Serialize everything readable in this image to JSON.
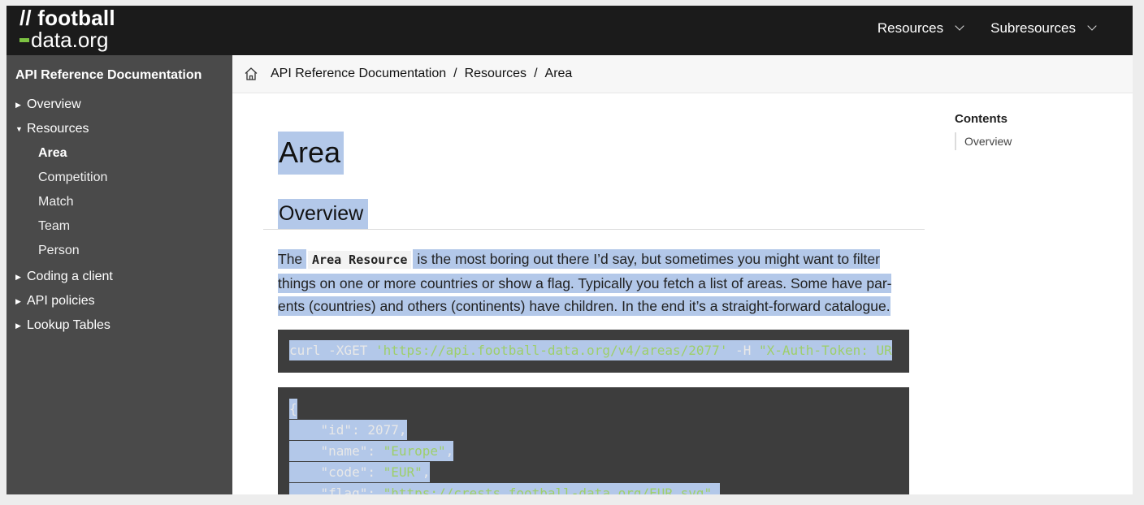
{
  "header": {
    "logo_line1": "// football",
    "logo_line2": "data.org",
    "nav": [
      {
        "label": "Resources"
      },
      {
        "label": "Subresources"
      }
    ]
  },
  "sidebar": {
    "title": "API Reference Documentation",
    "items": [
      {
        "label": "Overview",
        "expanded": false
      },
      {
        "label": "Resources",
        "expanded": true,
        "children": [
          "Area",
          "Competition",
          "Match",
          "Team",
          "Person"
        ],
        "active_child": "Area"
      },
      {
        "label": "Coding a client",
        "expanded": false
      },
      {
        "label": "API policies",
        "expanded": false
      },
      {
        "label": "Lookup Tables",
        "expanded": false
      }
    ]
  },
  "breadcrumb": [
    "API Reference Documentation",
    "Resources",
    "Area"
  ],
  "breadcrumb_sep": "/",
  "content": {
    "title": "Area",
    "section_heading": "Overview",
    "paragraph": {
      "before": "The",
      "code": "Area Resource",
      "after_line1": "is the most boring out there I’d say, but sometimes you might want to filter",
      "line2": "things on one or more countries or show a flag. Typically you fetch a list of areas. Some have par-",
      "line3": "ents (countries) and others (continents) have children. In the end it’s a straight-forward catalogue."
    },
    "curl": {
      "cmd": "curl -XGET",
      "url": "'https://api.football-data.org/v4/areas/2077'",
      "flag": "-H",
      "header": "\"X-Auth-Token: UR"
    },
    "json": {
      "open": "{",
      "lines": [
        {
          "key": "\"id\"",
          "value": "2077",
          "is_string": false,
          "comma": ","
        },
        {
          "key": "\"name\"",
          "value": "\"Europe\"",
          "is_string": true,
          "comma": ","
        },
        {
          "key": "\"code\"",
          "value": "\"EUR\"",
          "is_string": true,
          "comma": ","
        },
        {
          "key": "\"flag\"",
          "value": "\"https://crests.football-data.org/EUR.svg\"",
          "is_string": true,
          "comma": ","
        }
      ]
    }
  },
  "toc": {
    "title": "Contents",
    "items": [
      "Overview"
    ]
  },
  "colors": {
    "header_bg": "#1b1b1b",
    "sidebar_bg": "#4a4a4a",
    "accent_green": "#7cc242",
    "code_bg": "#3d3d3d",
    "code_string": "#9ecf6a",
    "selection": "#b3c8e9"
  }
}
